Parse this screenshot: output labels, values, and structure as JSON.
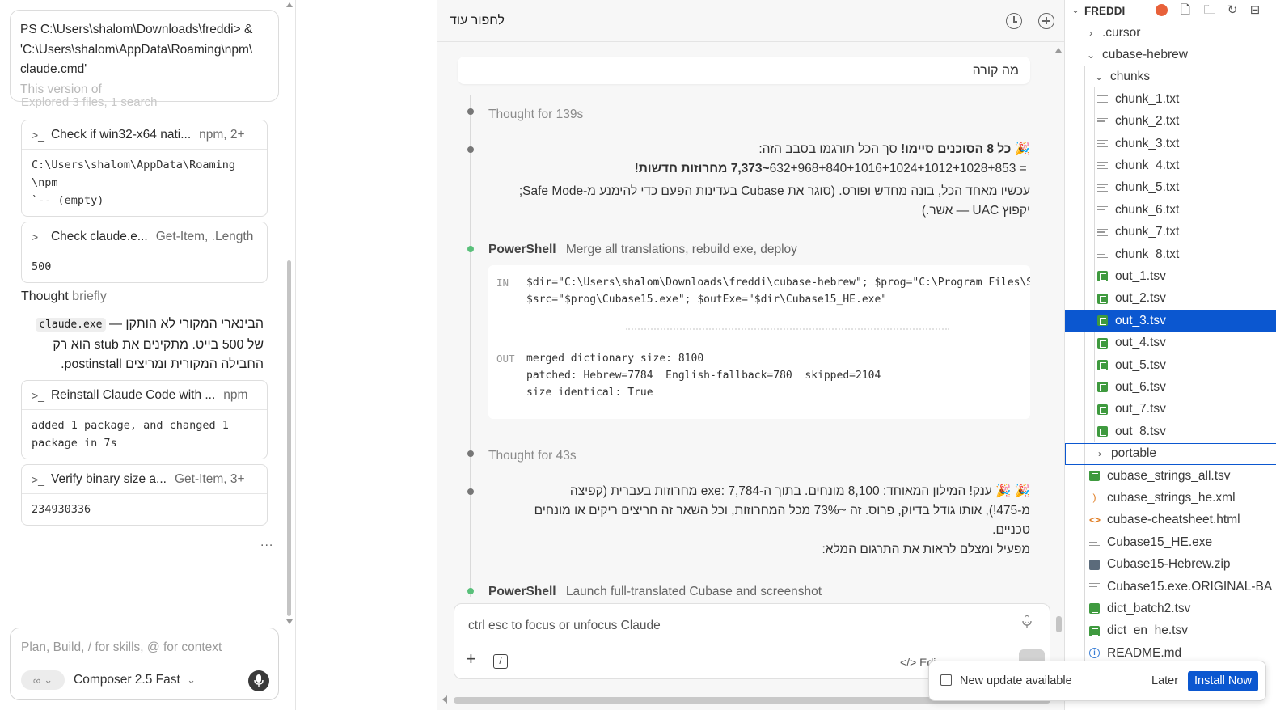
{
  "left_panel": {
    "top_note": {
      "line1": "PS C:\\Users\\shalom\\Downloads\\freddi> &",
      "line2": "'C:\\Users\\shalom\\AppData\\Roaming\\npm\\",
      "line3": "claude.cmd'",
      "line4": "This version of",
      "line5": "Explored 3 files, 1 search"
    },
    "cards": [
      {
        "title": "Check if win32-x64 nati...",
        "meta": "npm, 2+",
        "output": "C:\\Users\\shalom\\AppData\\Roaming\n\\npm\n`-- (empty)"
      },
      {
        "title": "Check claude.e...",
        "meta": "Get-Item, .Length",
        "output": "500"
      },
      {
        "title": "Reinstall Claude Code with ...",
        "meta": "npm",
        "output": "added 1 package, and changed 1\npackage in 7s"
      },
      {
        "title": "Verify binary size a...",
        "meta": "Get-Item, 3+",
        "output": "234930336"
      }
    ],
    "thought_label": "Thought",
    "thought_suffix": "briefly",
    "rtl_paragraph": {
      "part1": "הבינארי המקורי לא הותקן — ",
      "code": "claude.exe",
      "part2": " של 500 בייט. מתקינים את stub הוא רק החבילה המקורית ומריצים postinstall."
    },
    "more": "...",
    "composer": {
      "placeholder": "Plan, Build, / for skills, @ for context",
      "mode_icon": "infinity-icon",
      "model": "Composer 2.5 Fast"
    }
  },
  "middle_panel": {
    "title": "לחפור עוד",
    "user_message": "מה קורה",
    "thought1": "Thought for 139s",
    "msg1": {
      "line1_bold": "כל 8 הסוכנים סיימו!",
      "line1_rest": " סך הכל תורגמו בסבב הזה:",
      "emoji": "🎉",
      "line2_sum": "632+968+840+1016+1024+1012+1028+853 = ",
      "line2_bold": "~7,373 מחרוזות חדשות!",
      "line3": "עכשיו מאחד הכל, בונה מחדש ופורס. (סוגר את Cubase בעדינות הפעם כדי להימנע מ-Safe Mode;",
      "line4": "יקפוץ UAC — אשר.)"
    },
    "ps1": {
      "label": "PowerShell",
      "desc": "Merge all translations, rebuild exe, deploy",
      "in_tag": "IN",
      "in_line1": "$dir=\"C:\\Users\\shalom\\Downloads\\freddi\\cubase-hebrew\"; $prog=\"C:\\Program Files\\Ste",
      "in_line2": "$src=\"$prog\\Cubase15.exe\"; $outExe=\"$dir\\Cubase15_HE.exe\"",
      "out_tag": "OUT",
      "out_line1": "merged dictionary size: 8100",
      "out_line2": "patched: Hebrew=7784  English-fallback=780  skipped=2104",
      "out_line3": "size identical: True"
    },
    "thought2": "Thought for 43s",
    "msg2": {
      "line1": "🎉 🎉 ענק! המילון המאוחד: 8,100 מונחים. בתוך ה-exe: 7,784 מחרוזות בעברית (קפיצה",
      "line2": "מ-475!), אותו גודל בדיוק, פרוס. זה ~73% מכל המחרוזות, וכל השאר זה חריצים ריקים או מונחים",
      "line3": "טכניים.",
      "line4": "מפעיל ומצלם לראות את התרגום המלא:"
    },
    "ps2": {
      "label": "PowerShell",
      "desc": "Launch full-translated Cubase and screenshot"
    },
    "composer": {
      "placeholder": "ctrl esc to focus or unfocus Claude",
      "edit_label": "Edi"
    }
  },
  "explorer": {
    "root": "FREDDI",
    "items": [
      {
        "label": ".cursor",
        "type": "folder",
        "expanded": false,
        "depth": 1
      },
      {
        "label": "cubase-hebrew",
        "type": "folder",
        "expanded": true,
        "depth": 1
      },
      {
        "label": "chunks",
        "type": "folder",
        "expanded": true,
        "depth": 2
      },
      {
        "label": "chunk_1.txt",
        "type": "txt",
        "depth": 3
      },
      {
        "label": "chunk_2.txt",
        "type": "txt",
        "depth": 3
      },
      {
        "label": "chunk_3.txt",
        "type": "txt",
        "depth": 3
      },
      {
        "label": "chunk_4.txt",
        "type": "txt",
        "depth": 3
      },
      {
        "label": "chunk_5.txt",
        "type": "txt",
        "depth": 3
      },
      {
        "label": "chunk_6.txt",
        "type": "txt",
        "depth": 3
      },
      {
        "label": "chunk_7.txt",
        "type": "txt",
        "depth": 3
      },
      {
        "label": "chunk_8.txt",
        "type": "txt",
        "depth": 3
      },
      {
        "label": "out_1.tsv",
        "type": "tsv",
        "depth": 3
      },
      {
        "label": "out_2.tsv",
        "type": "tsv",
        "depth": 3
      },
      {
        "label": "out_3.tsv",
        "type": "tsv",
        "depth": 3,
        "selected": true
      },
      {
        "label": "out_4.tsv",
        "type": "tsv",
        "depth": 3
      },
      {
        "label": "out_5.tsv",
        "type": "tsv",
        "depth": 3
      },
      {
        "label": "out_6.tsv",
        "type": "tsv",
        "depth": 3
      },
      {
        "label": "out_7.tsv",
        "type": "tsv",
        "depth": 3
      },
      {
        "label": "out_8.tsv",
        "type": "tsv",
        "depth": 3
      },
      {
        "label": "portable",
        "type": "folder",
        "expanded": false,
        "depth": 2,
        "focused": true
      },
      {
        "label": "cubase_strings_all.tsv",
        "type": "tsv",
        "depth": 2
      },
      {
        "label": "cubase_strings_he.xml",
        "type": "rss",
        "depth": 2
      },
      {
        "label": "cubase-cheatsheet.html",
        "type": "html",
        "depth": 2
      },
      {
        "label": "Cubase15_HE.exe",
        "type": "txt",
        "depth": 2
      },
      {
        "label": "Cubase15-Hebrew.zip",
        "type": "zip",
        "depth": 2
      },
      {
        "label": "Cubase15.exe.ORIGINAL-BA",
        "type": "txt",
        "depth": 2
      },
      {
        "label": "dict_batch2.tsv",
        "type": "tsv",
        "depth": 2
      },
      {
        "label": "dict_en_he.tsv",
        "type": "tsv",
        "depth": 2
      },
      {
        "label": "README.md",
        "type": "info",
        "depth": 2
      }
    ]
  },
  "toast": {
    "message": "New update available",
    "later": "Later",
    "install": "Install Now"
  },
  "colors": {
    "accent": "#0b57d0",
    "tsv_green": "#3f9a3f",
    "timeline_green": "#59c07a"
  }
}
